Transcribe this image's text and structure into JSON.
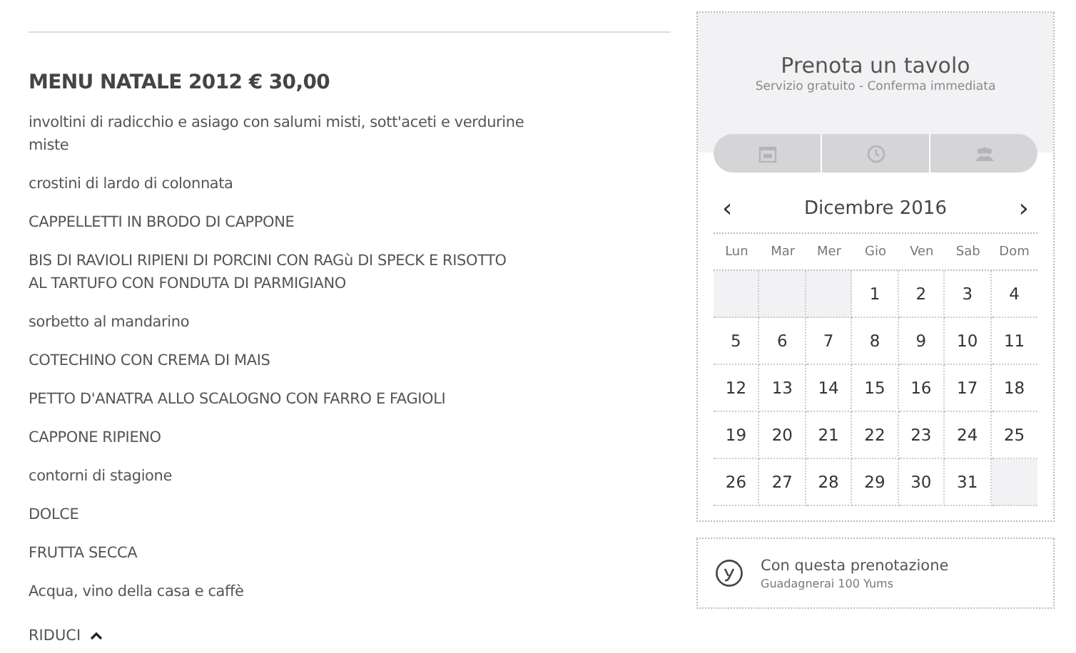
{
  "menu": {
    "title": "MENU NATALE 2012 € 30,00",
    "items": [
      "involtini di radicchio e asiago con salumi misti, sott'aceti e verdurine miste",
      "crostini di lardo di colonnata",
      "CAPPELLETTI IN BRODO DI CAPPONE",
      "BIS DI RAVIOLI RIPIENI DI PORCINI CON RAGù DI SPECK E RISOTTO AL TARTUFO CON FONDUTA DI PARMIGIANO",
      "sorbetto al mandarino",
      "COTECHINO CON CREMA DI MAIS",
      "PETTO D'ANATRA ALLO SCALOGNO CON FARRO E FAGIOLI",
      "CAPPONE RIPIENO",
      "contorni di stagione",
      "DOLCE",
      "FRUTTA SECCA",
      "Acqua, vino della casa e caffè"
    ],
    "collapse": "RIDUCI"
  },
  "booking": {
    "title": "Prenota un tavolo",
    "subtitle": "Servizio gratuito - Conferma immediata",
    "calendar": {
      "prev": "‹",
      "month": "Dicembre 2016",
      "next": "›",
      "weekdays": [
        "Lun",
        "Mar",
        "Mer",
        "Gio",
        "Ven",
        "Sab",
        "Dom"
      ],
      "weeks": [
        [
          {
            "kind": "empty"
          },
          {
            "kind": "empty"
          },
          {
            "kind": "empty"
          },
          {
            "kind": "day",
            "label": "1"
          },
          {
            "kind": "day",
            "label": "2"
          },
          {
            "kind": "day",
            "label": "3"
          },
          {
            "kind": "day",
            "label": "4"
          }
        ],
        [
          {
            "kind": "day",
            "label": "5"
          },
          {
            "kind": "day",
            "label": "6"
          },
          {
            "kind": "day",
            "label": "7"
          },
          {
            "kind": "day",
            "label": "8"
          },
          {
            "kind": "day",
            "label": "9"
          },
          {
            "kind": "day",
            "label": "10"
          },
          {
            "kind": "day",
            "label": "11"
          }
        ],
        [
          {
            "kind": "day",
            "label": "12"
          },
          {
            "kind": "day",
            "label": "13"
          },
          {
            "kind": "day",
            "label": "14"
          },
          {
            "kind": "day",
            "label": "15"
          },
          {
            "kind": "day",
            "label": "16"
          },
          {
            "kind": "day",
            "label": "17"
          },
          {
            "kind": "day",
            "label": "18"
          }
        ],
        [
          {
            "kind": "day",
            "label": "19"
          },
          {
            "kind": "day",
            "label": "20"
          },
          {
            "kind": "day",
            "label": "21"
          },
          {
            "kind": "day",
            "label": "22"
          },
          {
            "kind": "day",
            "label": "23"
          },
          {
            "kind": "day",
            "label": "24"
          },
          {
            "kind": "day",
            "label": "25"
          }
        ],
        [
          {
            "kind": "day",
            "label": "26"
          },
          {
            "kind": "day",
            "label": "27"
          },
          {
            "kind": "day",
            "label": "28"
          },
          {
            "kind": "day",
            "label": "29"
          },
          {
            "kind": "day",
            "label": "30"
          },
          {
            "kind": "day",
            "label": "31"
          },
          {
            "kind": "empty"
          }
        ]
      ]
    }
  },
  "reward": {
    "title": "Con questa prenotazione",
    "subtitle": "Guadagnerai 100 Yums"
  }
}
